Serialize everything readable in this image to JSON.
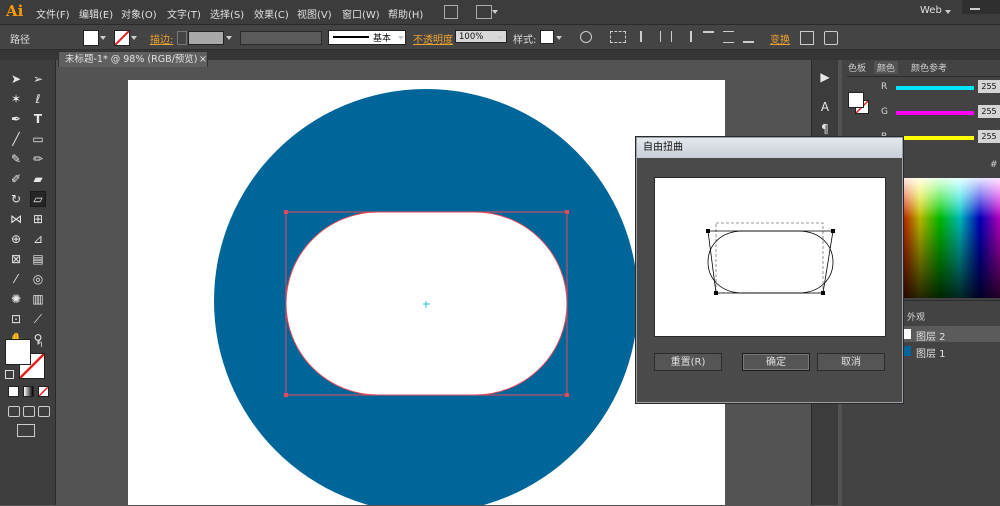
{
  "app": {
    "logo": "Ai",
    "workspace": "Web"
  },
  "menu": [
    "文件(F)",
    "编辑(E)",
    "对象(O)",
    "文字(T)",
    "选择(S)",
    "效果(C)",
    "视图(V)",
    "窗口(W)",
    "帮助(H)"
  ],
  "control_bar": {
    "selection_label": "路径",
    "stroke_label": "描边:",
    "stroke_style": "基本",
    "opacity_label": "不透明度",
    "opacity_value": "100%",
    "style_label": "样式:",
    "transform_label": "变换"
  },
  "document_tab": {
    "title": "未标题-1* @ 98% (RGB/预览)",
    "close": "×"
  },
  "color_panel": {
    "tabs": [
      "色板",
      "颜色",
      "颜色参考"
    ],
    "channels": [
      {
        "label": "R",
        "value": "255",
        "color": "#00e5ff"
      },
      {
        "label": "G",
        "value": "255",
        "color": "#ff00ff"
      },
      {
        "label": "B",
        "value": "255",
        "color": "#ffff00"
      }
    ],
    "hash": "#"
  },
  "layers_panel": {
    "tab": "外观",
    "layers": [
      {
        "name": "图层 2"
      },
      {
        "name": "图层 1"
      }
    ]
  },
  "dialog": {
    "title": "自由扭曲",
    "reset_button": "重置(R)",
    "ok_button": "确定",
    "cancel_button": "取消"
  },
  "colors": {
    "ring": "#006699",
    "selection": "#e8495a",
    "accent": "#ff9a00"
  }
}
